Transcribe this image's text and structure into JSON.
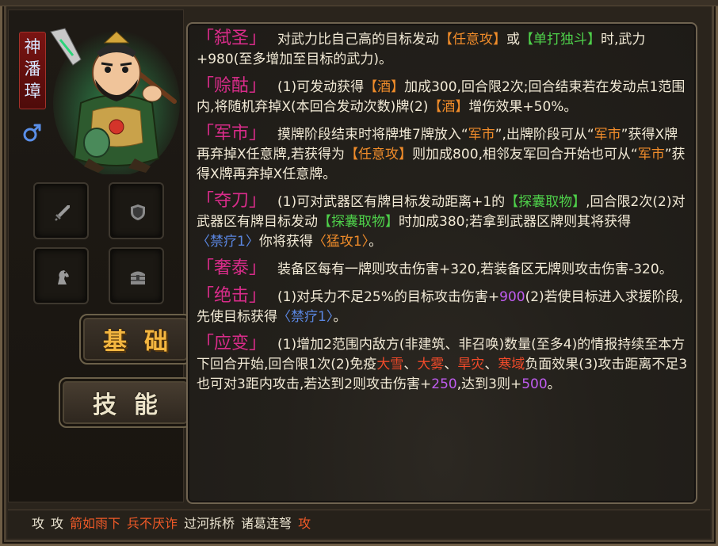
{
  "hero": {
    "name_chars": [
      "神",
      "潘",
      "璋"
    ],
    "gender_icon": "male-symbol-icon"
  },
  "equipment_slots": [
    {
      "icon": "sword-icon"
    },
    {
      "icon": "shield-icon"
    },
    {
      "icon": "horse-icon"
    },
    {
      "icon": "treasure-chest-icon"
    }
  ],
  "tabs": {
    "basic": "基础",
    "skills": "技能"
  },
  "skills": [
    {
      "name": "「弑圣」",
      "parts": [
        {
          "t": "对武力比自己高的目标发动",
          "c": ""
        },
        {
          "t": "【任意攻】",
          "c": "orange"
        },
        {
          "t": "或",
          "c": ""
        },
        {
          "t": "【单打独斗】",
          "c": "green"
        },
        {
          "t": "时,武力+980(至多增加至目标的武力)。",
          "c": ""
        }
      ]
    },
    {
      "name": "「赊酤」",
      "parts": [
        {
          "t": "(1)可发动获得",
          "c": ""
        },
        {
          "t": "【酒】",
          "c": "orange"
        },
        {
          "t": "加成300,回合限2次;回合结束若在发动点1范围内,将随机弃掉X(本回合发动次数)牌(2)",
          "c": ""
        },
        {
          "t": "【酒】",
          "c": "orange"
        },
        {
          "t": "增伤效果+50%。",
          "c": ""
        }
      ]
    },
    {
      "name": "「军市」",
      "parts": [
        {
          "t": "摸牌阶段结束时将牌堆7牌放入“",
          "c": ""
        },
        {
          "t": "军市",
          "c": "orange"
        },
        {
          "t": "”,出牌阶段可从“",
          "c": ""
        },
        {
          "t": "军市",
          "c": "orange"
        },
        {
          "t": "”获得X牌再弃掉X任意牌,若获得为",
          "c": ""
        },
        {
          "t": "【任意攻】",
          "c": "orange"
        },
        {
          "t": "则加成800,相邻友军回合开始也可从“",
          "c": ""
        },
        {
          "t": "军市",
          "c": "orange"
        },
        {
          "t": "”获得X牌再弃掉X任意牌。",
          "c": ""
        }
      ]
    },
    {
      "name": "「夺刀」",
      "parts": [
        {
          "t": "(1)可对武器区有牌目标发动距离+1的",
          "c": ""
        },
        {
          "t": "【探囊取物】",
          "c": "green"
        },
        {
          "t": ",回合限2次(2)对武器区有牌目标发动",
          "c": ""
        },
        {
          "t": "【探囊取物】",
          "c": "green"
        },
        {
          "t": "时加成380;若拿到武器区牌则其将获得",
          "c": ""
        },
        {
          "t": "〈禁疗1〉",
          "c": "blue"
        },
        {
          "t": "你将获得",
          "c": ""
        },
        {
          "t": "〈猛攻1〉",
          "c": "orange"
        },
        {
          "t": "。",
          "c": ""
        }
      ]
    },
    {
      "name": "「奢泰」",
      "parts": [
        {
          "t": "装备区每有一牌则攻击伤害+320,若装备区无牌则攻击伤害-320。",
          "c": ""
        }
      ]
    },
    {
      "name": "「绝击」",
      "parts": [
        {
          "t": "(1)对兵力不足25%的目标攻击伤害+",
          "c": ""
        },
        {
          "t": "900",
          "c": "purple"
        },
        {
          "t": "(2)若使目标进入求援阶段,先使目标获得",
          "c": ""
        },
        {
          "t": "〈禁疗1〉",
          "c": "blue"
        },
        {
          "t": "。",
          "c": ""
        }
      ]
    },
    {
      "name": "「应变」",
      "parts": [
        {
          "t": "(1)增加2范围内敌方(非建筑、非召唤)数量(至多4)的情报持续至本方下回合开始,回合限1次(2)免疫",
          "c": ""
        },
        {
          "t": "大雪",
          "c": "red"
        },
        {
          "t": "、",
          "c": ""
        },
        {
          "t": "大雾",
          "c": "red"
        },
        {
          "t": "、",
          "c": ""
        },
        {
          "t": "旱灾",
          "c": "red"
        },
        {
          "t": "、",
          "c": ""
        },
        {
          "t": "寒域",
          "c": "red"
        },
        {
          "t": "负面效果(3)攻击距离不足3也可对3距内攻击,若达到2则攻击伤害+",
          "c": ""
        },
        {
          "t": "250",
          "c": "purple"
        },
        {
          "t": ",达到3则+",
          "c": ""
        },
        {
          "t": "500",
          "c": "purple"
        },
        {
          "t": "。",
          "c": ""
        }
      ]
    }
  ],
  "tags": [
    {
      "t": "攻",
      "c": ""
    },
    {
      "t": "攻",
      "c": ""
    },
    {
      "t": "箭如雨下",
      "c": "red"
    },
    {
      "t": "兵不厌诈",
      "c": "red"
    },
    {
      "t": "过河拆桥",
      "c": ""
    },
    {
      "t": "诸葛连弩",
      "c": ""
    },
    {
      "t": "攻",
      "c": "red"
    }
  ],
  "colors": {
    "skill_name": "#d92c8a",
    "orange": "#f08c2a",
    "green": "#4ed04a",
    "blue": "#5a86e0",
    "red": "#f04a2a",
    "purple": "#c05cf0",
    "tab_active": "#f3b640"
  }
}
